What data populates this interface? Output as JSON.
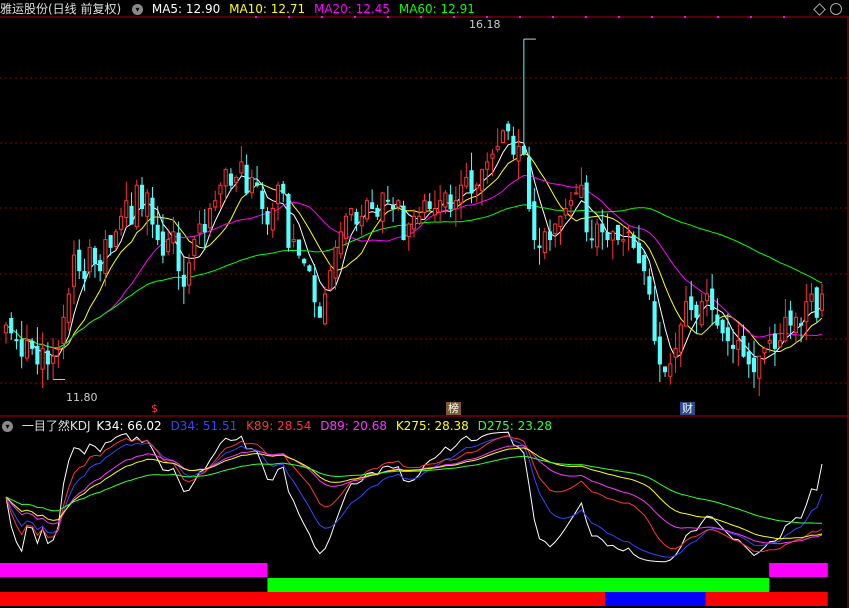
{
  "header": {
    "title": "雅运股份(日线 前复权)",
    "ma": [
      {
        "label": "MA5: 12.90",
        "color": "#ffffff"
      },
      {
        "label": "MA10: 12.71",
        "color": "#ffff00"
      },
      {
        "label": "MA20: 12.45",
        "color": "#ff00ff"
      },
      {
        "label": "MA60: 12.91",
        "color": "#00ff00"
      }
    ]
  },
  "price_panel": {
    "high_label": "16.18",
    "low_label": "11.80",
    "markers": [
      {
        "text": "$",
        "color": "#ff3333",
        "bg": "transparent",
        "x_index": 34
      },
      {
        "text": "榜",
        "color": "#ffffff",
        "bg": "#7a5a2a",
        "x_index": 99
      },
      {
        "text": "财",
        "color": "#ffffff",
        "bg": "#2a4a8a",
        "x_index": 149
      }
    ]
  },
  "kdj_header": {
    "title": "一目了然KDJ",
    "items": [
      {
        "label": "K34: 66.02",
        "color": "#ffffff"
      },
      {
        "label": "D34: 51.51",
        "color": "#3344ff"
      },
      {
        "label": "K89: 28.54",
        "color": "#ff3333"
      },
      {
        "label": "D89: 20.68",
        "color": "#ff33ff"
      },
      {
        "label": "K275: 28.38",
        "color": "#ffff00"
      },
      {
        "label": "D275: 23.28",
        "color": "#33ff33"
      }
    ]
  },
  "chart_data": [
    {
      "type": "candlestick",
      "title": "雅运股份(日线 前复权)",
      "ylim": [
        11.6,
        16.4
      ],
      "high": 16.18,
      "low": 11.8,
      "ma_last": {
        "MA5": 12.9,
        "MA10": 12.71,
        "MA20": 12.45,
        "MA60": 12.91
      },
      "close": [
        12.5,
        12.4,
        12.3,
        12.1,
        12.3,
        12.2,
        12.0,
        12.2,
        12.0,
        12.1,
        12.2,
        12.6,
        12.9,
        13.4,
        13.2,
        13.1,
        13.5,
        13.3,
        13.2,
        13.6,
        13.5,
        13.7,
        13.9,
        14.1,
        13.8,
        14.3,
        14.0,
        14.2,
        13.8,
        13.6,
        13.4,
        13.6,
        13.7,
        13.2,
        13.0,
        13.3,
        13.6,
        13.8,
        13.7,
        14.0,
        14.1,
        14.3,
        14.5,
        14.3,
        14.4,
        14.6,
        14.2,
        14.4,
        14.3,
        14.0,
        13.8,
        14.0,
        14.3,
        14.2,
        13.5,
        13.6,
        13.4,
        13.3,
        13.2,
        12.8,
        12.6,
        12.9,
        13.2,
        13.5,
        13.7,
        13.9,
        14.0,
        13.8,
        13.9,
        14.1,
        14.0,
        13.9,
        14.2,
        14.1,
        14.0,
        14.1,
        13.6,
        13.8,
        13.9,
        13.9,
        14.1,
        14.0,
        14.0,
        14.1,
        14.2,
        14.0,
        14.1,
        14.3,
        14.4,
        14.2,
        14.3,
        14.5,
        14.6,
        14.7,
        14.8,
        15.0,
        15.0,
        14.7,
        14.8,
        14.7,
        14.0,
        13.6,
        13.5,
        13.7,
        13.6,
        13.8,
        13.9,
        14.0,
        14.1,
        14.2,
        14.3,
        13.7,
        13.6,
        13.8,
        13.7,
        13.6,
        13.7,
        13.6,
        13.6,
        13.7,
        13.5,
        13.3,
        13.2,
        12.9,
        12.3,
        12.0,
        11.9,
        12.0,
        12.2,
        12.5,
        12.8,
        12.7,
        12.6,
        12.8,
        12.9,
        12.7,
        12.5,
        12.4,
        12.3,
        12.2,
        12.3,
        12.1,
        12.0,
        11.9,
        12.1,
        12.2,
        12.3,
        12.2,
        12.3,
        12.6,
        12.5,
        12.6,
        12.5,
        12.8,
        12.9,
        12.6,
        12.9
      ],
      "bars_count": 158
    },
    {
      "type": "line",
      "title": "一目了然KDJ",
      "series": [
        {
          "name": "K34",
          "last": 66.02
        },
        {
          "name": "D34",
          "last": 51.51
        },
        {
          "name": "K89",
          "last": 28.54
        },
        {
          "name": "D89",
          "last": 20.68
        },
        {
          "name": "K275",
          "last": 28.38
        },
        {
          "name": "D275",
          "last": 23.28
        }
      ],
      "ylim": [
        0,
        100
      ]
    }
  ],
  "strips": {
    "row1": [
      {
        "color": "#ff00ff",
        "from": 0,
        "to": 0.315
      },
      {
        "color": "#ff00ff",
        "from": 0.906,
        "to": 0.975
      }
    ],
    "row2": [
      {
        "color": "#00ff00",
        "from": 0.315,
        "to": 0.906
      }
    ],
    "row3": [
      {
        "color": "#ff0000",
        "from": 0,
        "to": 0.713
      },
      {
        "color": "#0000ff",
        "from": 0.713,
        "to": 0.831
      },
      {
        "color": "#ff0000",
        "from": 0.831,
        "to": 0.975
      }
    ]
  },
  "colors": {
    "up": "#ff3232",
    "down": "#54ffff",
    "grid": "#8b0000",
    "border": "#b00000"
  }
}
